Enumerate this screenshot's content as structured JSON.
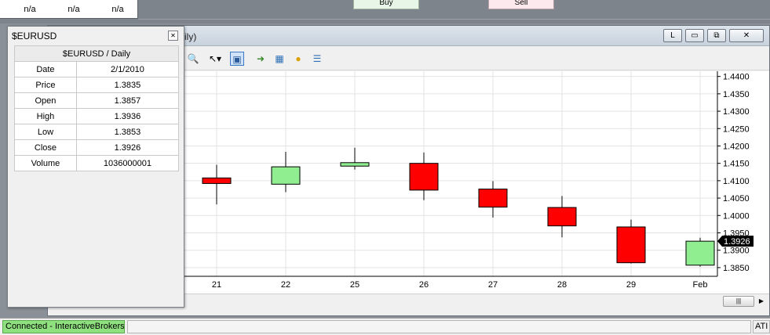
{
  "top": {
    "na_values": [
      "n/a",
      "n/a",
      "n/a"
    ],
    "buy_label": "Buy",
    "sell_label": "Sell"
  },
  "chart_window": {
    "title_suffix": "ily)",
    "button_l": "L",
    "button_min": "▭",
    "button_restore": "⧉",
    "button_close": "✕",
    "toolbar_icons": [
      "zoom-icon",
      "pointer-icon",
      "crosshair-icon",
      "strategy-icon",
      "indicator-icon",
      "coin-icon",
      "list-icon"
    ]
  },
  "data_box": {
    "title": "$EURUSD",
    "header": "$EURUSD / Daily",
    "rows": [
      {
        "label": "Date",
        "value": "2/1/2010"
      },
      {
        "label": "Price",
        "value": "1.3835"
      },
      {
        "label": "Open",
        "value": "1.3857"
      },
      {
        "label": "High",
        "value": "1.3936"
      },
      {
        "label": "Low",
        "value": "1.3853"
      },
      {
        "label": "Close",
        "value": "1.3926"
      },
      {
        "label": "Volume",
        "value": "1036000001"
      }
    ]
  },
  "chart_data": {
    "type": "candlestick",
    "x_labels": [
      "21",
      "22",
      "25",
      "26",
      "27",
      "28",
      "29",
      "Feb"
    ],
    "candles": [
      {
        "x": "21",
        "open": 1.4108,
        "high": 1.4146,
        "low": 1.4032,
        "close": 1.4092
      },
      {
        "x": "22",
        "open": 1.409,
        "high": 1.4183,
        "low": 1.4067,
        "close": 1.414
      },
      {
        "x": "25",
        "open": 1.4142,
        "high": 1.4195,
        "low": 1.4132,
        "close": 1.4152
      },
      {
        "x": "26",
        "open": 1.415,
        "high": 1.4181,
        "low": 1.4044,
        "close": 1.4073
      },
      {
        "x": "27",
        "open": 1.4076,
        "high": 1.4099,
        "low": 1.3994,
        "close": 1.4024
      },
      {
        "x": "28",
        "open": 1.4023,
        "high": 1.4056,
        "low": 1.3937,
        "close": 1.397
      },
      {
        "x": "29",
        "open": 1.3967,
        "high": 1.3988,
        "low": 1.3862,
        "close": 1.3864
      },
      {
        "x": "Feb",
        "open": 1.3857,
        "high": 1.3936,
        "low": 1.3853,
        "close": 1.3926
      }
    ],
    "ylim": [
      1.3825,
      1.4415
    ],
    "y_ticks": [
      "1.4400",
      "1.4350",
      "1.4300",
      "1.4250",
      "1.4200",
      "1.4150",
      "1.4100",
      "1.4050",
      "1.4000",
      "1.3950",
      "1.3900",
      "1.3850"
    ],
    "last_price_label": "1.3926",
    "last_price": 1.3926,
    "colors": {
      "up": "#90ee90",
      "down": "#ff0000",
      "grid": "#e3e3e3",
      "label_bg": "#000000"
    }
  },
  "status": {
    "connection": "Connected - InteractiveBrokers",
    "right_text": "ATI"
  }
}
